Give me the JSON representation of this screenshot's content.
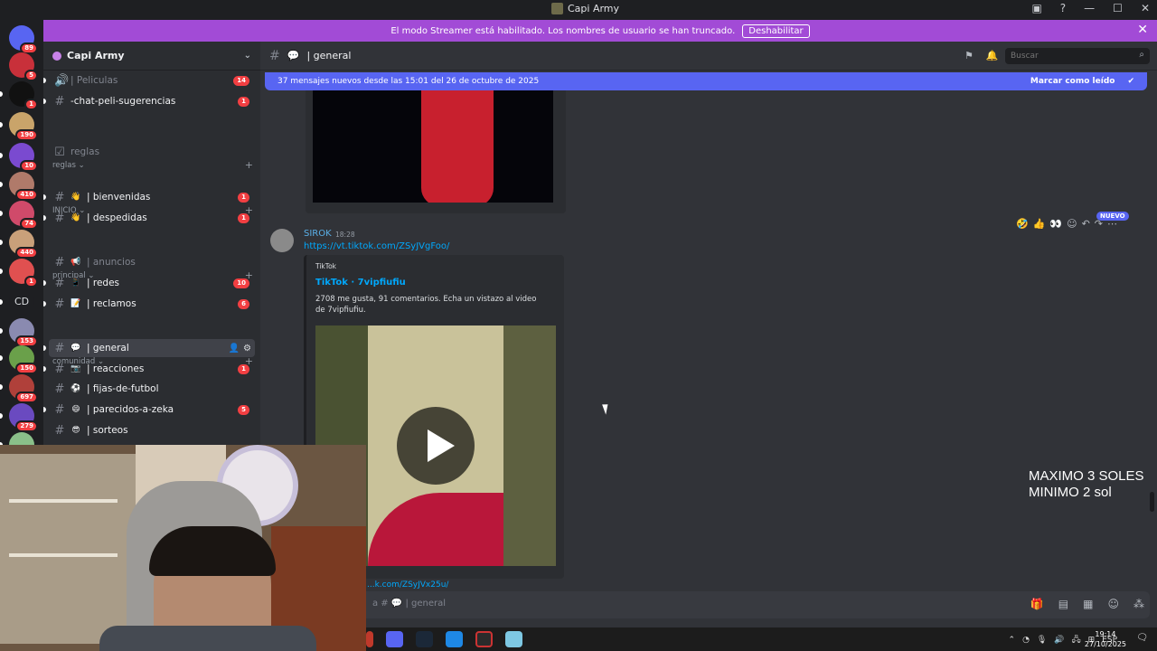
{
  "window": {
    "title": "Capi Army"
  },
  "banner": {
    "text": "El modo Streamer está habilitado. Los nombres de usuario se han truncado.",
    "disable_label": "Deshabilitar"
  },
  "servers": [
    {
      "badge": "89",
      "color": "#5865f2"
    },
    {
      "badge": "5",
      "color": "#c8303a"
    },
    {
      "badge": "1",
      "color": "#111111"
    },
    {
      "badge": "190",
      "color": "#c9a46a"
    },
    {
      "badge": "10",
      "color": "#7a4ad0"
    },
    {
      "badge": "410",
      "color": "#b07a6a"
    },
    {
      "badge": "74",
      "color": "#d04a6a"
    },
    {
      "badge": "440",
      "color": "#c9a07a"
    },
    {
      "badge": "1",
      "color": "#e05050"
    },
    {
      "label": "CD",
      "badge": "",
      "color": "#1e1f22"
    },
    {
      "badge": "153",
      "color": "#8a8ab0"
    },
    {
      "badge": "150",
      "color": "#6aa04a"
    },
    {
      "badge": "697",
      "color": "#b0403a"
    },
    {
      "badge": "279",
      "color": "#6a4ac0"
    },
    {
      "badge": "",
      "color": "#8ac08a"
    }
  ],
  "sidebar": {
    "server_name": "Capi Army",
    "channels": [
      {
        "icon": "🔊",
        "name": "| Peliculas",
        "count": "14",
        "muted": true
      },
      {
        "icon": "#",
        "name": "-chat-peli-sugerencias",
        "count": "1"
      },
      {
        "category": "reglas"
      },
      {
        "icon": "☑",
        "name": "reglas",
        "muted": true
      },
      {
        "category": "INICIO"
      },
      {
        "icon": "#",
        "name": "| bienvenidas",
        "count": "1",
        "emoji": "👋"
      },
      {
        "icon": "#",
        "name": "| despedidas",
        "count": "1",
        "emoji": "👋"
      },
      {
        "category": "principal"
      },
      {
        "icon": "#",
        "name": "| anuncios",
        "muted": true,
        "emoji": "📢"
      },
      {
        "icon": "#",
        "name": "| redes",
        "count": "10",
        "emoji": "📱"
      },
      {
        "icon": "#",
        "name": "| reclamos",
        "count": "6",
        "emoji": "📝"
      },
      {
        "category": "comunidad"
      },
      {
        "icon": "#",
        "name": "| general",
        "active": true,
        "emoji": "💬"
      },
      {
        "icon": "#",
        "name": "| reacciones",
        "count": "1",
        "emoji": "📷"
      },
      {
        "icon": "#",
        "name": "| fijas-de-futbol",
        "emoji": "⚽"
      },
      {
        "icon": "#",
        "name": "| parecidos-a-zeka",
        "count": "5",
        "emoji": "😄"
      },
      {
        "icon": "#",
        "name": "| sorteos",
        "emoji": "😎"
      }
    ]
  },
  "chat_header": {
    "channel": "| general",
    "search_placeholder": "Buscar"
  },
  "new_messages_bar": {
    "text": "37 mensajes nuevos desde las 15:01 del 26 de octubre de 2025",
    "mark_read": "Marcar como leído"
  },
  "message": {
    "author": "SIROK",
    "time": "18:28",
    "link": "https://vt.tiktok.com/ZSyJVgFoo/",
    "embed": {
      "provider": "TikTok",
      "title": "TikTok · 7vipfiufiu",
      "description": "2708 me gusta, 91 comentarios. Echa un vistazo al video de 7vipfiufiu."
    },
    "next_link": "...k.com/ZSyJVx25u/"
  },
  "new_label": "NUEVO",
  "overlay": {
    "line1": "MAXIMO 3 SOLES",
    "line2": "MINIMO 2 sol"
  },
  "composer": {
    "placeholder": "a # 💬 | general"
  },
  "taskbar": {
    "lang": "ESP",
    "time": "19:14",
    "date": "27/10/2025"
  }
}
